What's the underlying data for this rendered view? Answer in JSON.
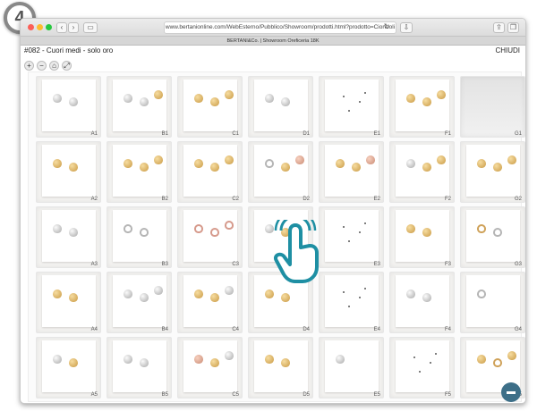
{
  "step_badge": "4",
  "browser": {
    "url": "www.bertanionline.com/WebEsterno/Pubblico/Showroom/prodotti.html?prodotto=Ciondoli",
    "tab_title": "BERTANI&Co. | Showroom Oreficeria 18K",
    "back_icon": "chevron-left-icon",
    "forward_icon": "chevron-right-icon"
  },
  "header": {
    "title": "#082 - Cuori medi - solo oro",
    "close_label": "CHIUDI"
  },
  "controls": {
    "zoom_in_icon": "+",
    "zoom_out_icon": "−",
    "home_icon": "⌂",
    "fit_icon": "⤢"
  },
  "grid": {
    "cells": [
      {
        "label": "A1",
        "items": [
          "silver",
          "silver"
        ]
      },
      {
        "label": "B1",
        "items": [
          "silver",
          "silver",
          "gold"
        ]
      },
      {
        "label": "C1",
        "items": [
          "gold",
          "gold",
          "gold"
        ]
      },
      {
        "label": "D1",
        "items": [
          "silver",
          "silver"
        ]
      },
      {
        "label": "E1",
        "items": [
          "dots"
        ]
      },
      {
        "label": "F1",
        "items": [
          "gold",
          "gold",
          "gold"
        ]
      },
      {
        "label": "G1",
        "items": [
          "blank"
        ]
      },
      {
        "label": "A2",
        "items": [
          "gold",
          "gold"
        ]
      },
      {
        "label": "B2",
        "items": [
          "gold",
          "gold",
          "gold"
        ]
      },
      {
        "label": "C2",
        "items": [
          "gold",
          "gold",
          "gold"
        ]
      },
      {
        "label": "D2",
        "items": [
          "ring-s",
          "gold",
          "rose"
        ]
      },
      {
        "label": "E2",
        "items": [
          "gold",
          "gold",
          "rose"
        ]
      },
      {
        "label": "F2",
        "items": [
          "silver",
          "gold",
          "gold"
        ]
      },
      {
        "label": "G2",
        "items": [
          "gold",
          "gold",
          "gold"
        ]
      },
      {
        "label": "A3",
        "items": [
          "silver",
          "silver"
        ]
      },
      {
        "label": "B3",
        "items": [
          "ring-s",
          "ring-s"
        ]
      },
      {
        "label": "C3",
        "items": [
          "ring-r",
          "ring-r",
          "ring-r"
        ]
      },
      {
        "label": "D3",
        "items": [
          "silver",
          "gold"
        ]
      },
      {
        "label": "E3",
        "items": [
          "dots"
        ]
      },
      {
        "label": "F3",
        "items": [
          "gold",
          "gold"
        ]
      },
      {
        "label": "G3",
        "items": [
          "ring",
          "ring-s"
        ]
      },
      {
        "label": "A4",
        "items": [
          "gold",
          "gold"
        ]
      },
      {
        "label": "B4",
        "items": [
          "silver",
          "silver",
          "silver"
        ]
      },
      {
        "label": "C4",
        "items": [
          "gold",
          "gold",
          "silver"
        ]
      },
      {
        "label": "D4",
        "items": [
          "gold",
          "gold"
        ]
      },
      {
        "label": "E4",
        "items": [
          "dots"
        ]
      },
      {
        "label": "F4",
        "items": [
          "silver",
          "silver"
        ]
      },
      {
        "label": "G4",
        "items": [
          "ring-s"
        ]
      },
      {
        "label": "A5",
        "items": [
          "silver",
          "gold"
        ]
      },
      {
        "label": "B5",
        "items": [
          "silver",
          "silver"
        ]
      },
      {
        "label": "C5",
        "items": [
          "rose",
          "gold",
          "silver"
        ]
      },
      {
        "label": "D5",
        "items": [
          "gold",
          "gold"
        ]
      },
      {
        "label": "E5",
        "items": [
          "silver"
        ]
      },
      {
        "label": "F5",
        "items": [
          "dots"
        ]
      },
      {
        "label": "G5",
        "items": [
          "gold",
          "ring",
          "gold"
        ]
      }
    ]
  },
  "chat_icon": "chat-bubble-icon",
  "pointer_icon": "tap-hand-icon"
}
